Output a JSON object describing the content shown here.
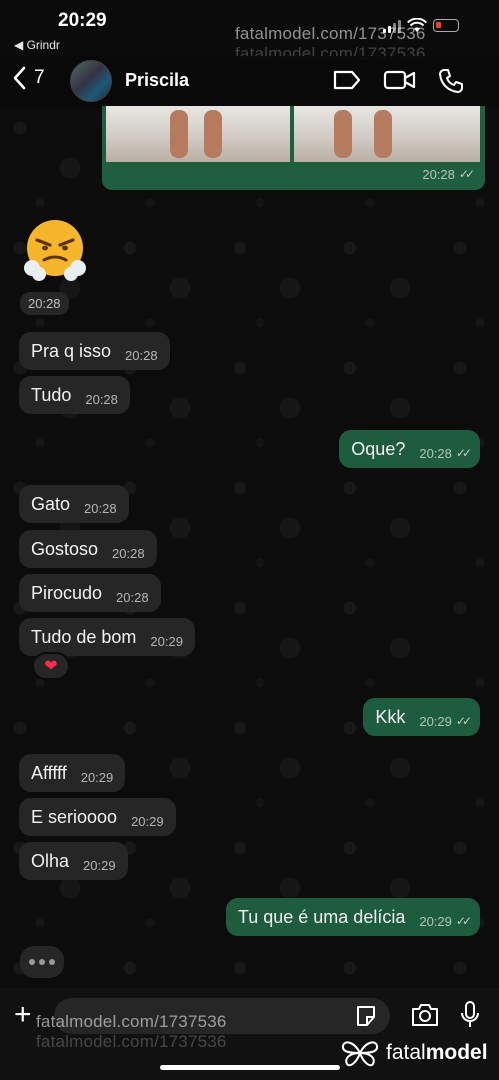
{
  "status_bar": {
    "time": "20:29",
    "back_app": "◀ Grindr"
  },
  "watermarks": {
    "top_1": "fatalmodel.com/1737536",
    "top_2": "fatalmodel.com/1737536",
    "bottom_1": "fatalmodel.com/1737536",
    "bottom_2": "fatalmodel.com/1737536",
    "brand_regular": "fatal",
    "brand_bold": "model"
  },
  "header": {
    "back_count": "7",
    "contact_name": "Priscila",
    "icons": [
      "tag-icon",
      "video-call-icon",
      "phone-icon"
    ]
  },
  "images_message": {
    "time": "20:28"
  },
  "emoji_message": {
    "emoji": "😤",
    "time": "20:28"
  },
  "messages": [
    {
      "dir": "in",
      "text": "Pra q isso",
      "time": "20:28"
    },
    {
      "dir": "in",
      "text": "Tudo",
      "time": "20:28"
    },
    {
      "dir": "out",
      "text": "Oque?",
      "time": "20:28"
    },
    {
      "dir": "in",
      "text": "Gato",
      "time": "20:28"
    },
    {
      "dir": "in",
      "text": "Gostoso",
      "time": "20:28"
    },
    {
      "dir": "in",
      "text": "Pirocudo",
      "time": "20:28"
    },
    {
      "dir": "in",
      "text": "Tudo de bom",
      "time": "20:29"
    },
    {
      "dir": "out",
      "text": "Kkk",
      "time": "20:29"
    },
    {
      "dir": "in",
      "text": "Afffff",
      "time": "20:29"
    },
    {
      "dir": "in",
      "text": "E serioooo",
      "time": "20:29"
    },
    {
      "dir": "in",
      "text": "Olha",
      "time": "20:29"
    },
    {
      "dir": "out",
      "text": "Tu que é uma delícia",
      "time": "20:29"
    }
  ],
  "reaction": {
    "emoji": "❤"
  },
  "colors": {
    "incoming_bubble": "#262626",
    "outgoing_bubble": "#1d5c3d",
    "background": "#0b0b0b"
  }
}
